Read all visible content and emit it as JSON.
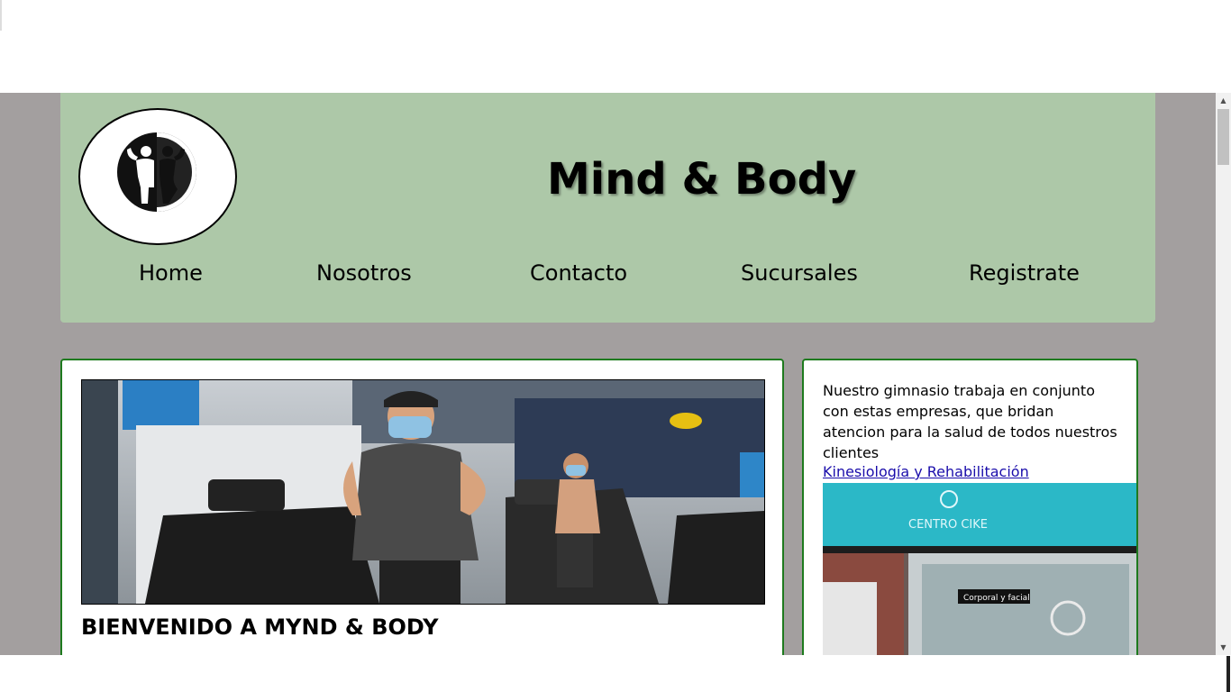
{
  "header": {
    "site_title": "Mind & Body"
  },
  "nav": {
    "items": [
      {
        "label": "Home"
      },
      {
        "label": "Nosotros"
      },
      {
        "label": "Contacto"
      },
      {
        "label": "Sucursales"
      },
      {
        "label": "Registrate"
      }
    ]
  },
  "main": {
    "welcome": "BIENVENIDO A MYND & BODY"
  },
  "sidebar": {
    "intro": "Nuestro gimnasio trabaja en conjunto con estas empresas, que bridan atencion para la salud de todos nuestros clientes",
    "link_label": "Kinesiología y Rehabilitación",
    "photo_sign": "CENTRO CIKE",
    "photo_sign_small": "Corporal y facial"
  },
  "colors": {
    "header_bg": "#adc8a8",
    "page_bg": "#a39f9f",
    "card_border": "#1e7a1e",
    "link": "#1a0dab"
  }
}
